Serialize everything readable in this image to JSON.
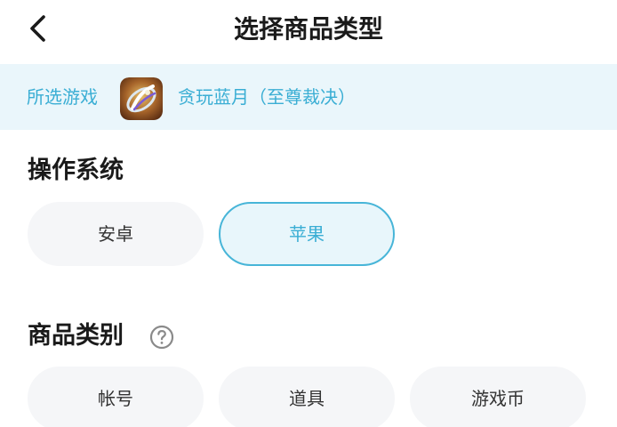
{
  "header": {
    "title": "选择商品类型",
    "back_icon": "chevron-left-icon"
  },
  "selected_game": {
    "label": "所选游戏",
    "name": "贪玩蓝月（至尊裁决）",
    "avatar_icon": "game-avatar"
  },
  "os_section": {
    "title": "操作系统",
    "options": [
      {
        "label": "安卓",
        "selected": false
      },
      {
        "label": "苹果",
        "selected": true
      }
    ]
  },
  "category_section": {
    "title": "商品类别",
    "help_icon": "question-circle-icon",
    "options": [
      {
        "label": "帐号"
      },
      {
        "label": "道具"
      },
      {
        "label": "游戏币"
      }
    ]
  },
  "colors": {
    "accent": "#3aaed4",
    "accent_border": "#47b5d8",
    "banner_bg": "#eaf6fb",
    "pill_bg": "#f5f6f8",
    "selected_pill_bg": "#e8f6fb"
  }
}
